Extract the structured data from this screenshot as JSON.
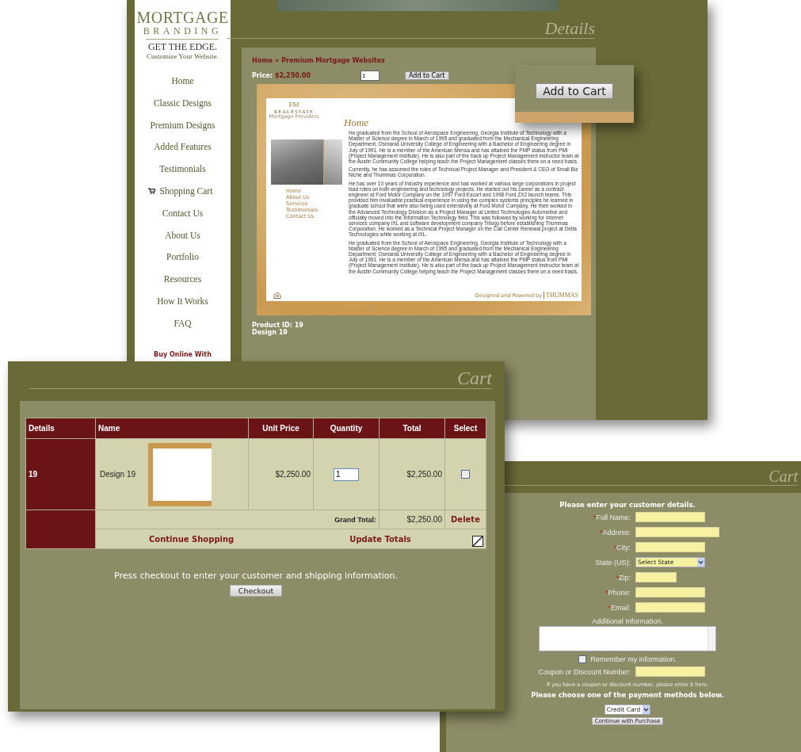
{
  "details_window": {
    "logo": {
      "line1": "MORTGAGE",
      "line2": "BRANDING",
      "tagline": "GET THE EDGE.",
      "subtagline": "Customize Your Website."
    },
    "nav": [
      {
        "label": "Home",
        "kind": "link"
      },
      {
        "label": "Classic Designs",
        "kind": "link"
      },
      {
        "label": "Premium Designs",
        "kind": "link"
      },
      {
        "label": "Added Features",
        "kind": "link"
      },
      {
        "label": "Testimonials",
        "kind": "link"
      },
      {
        "label": "Shopping Cart",
        "kind": "cart"
      },
      {
        "label": "Contact Us",
        "kind": "link"
      },
      {
        "label": "About Us",
        "kind": "link"
      },
      {
        "label": "Portfolio",
        "kind": "link"
      },
      {
        "label": "Resources",
        "kind": "link"
      },
      {
        "label": "How It Works",
        "kind": "link"
      },
      {
        "label": "FAQ",
        "kind": "link"
      }
    ],
    "buy_online": "Buy Online With",
    "title": "Details",
    "breadcrumb": {
      "home": "Home",
      "separator": "»",
      "current": "Premium Mortgage Websites"
    },
    "price_label": "Price:",
    "price": "$2,250.00",
    "quantity": "1",
    "add_button": "Add to Cart",
    "preview": {
      "logo_initials": "FM",
      "logo_name": "REALESTATE",
      "logo_sub": "Mortgage Providers",
      "heading": "Home",
      "nav": [
        "Home",
        "About Us",
        "Services",
        "Testimonials",
        "Contact Us"
      ],
      "paragraphs": [
        "He graduated from the School of Aerospace Engineering, Georgia Institute of Technology with a Master of Science degree in March of 1995 and graduated from the Mechanical Engineering Department, Osmania University College of Engineering with a Bachelor of Engineering degree in July of 1991. He is a member of the American Mensa and has attained the PMP status from PMI (Project Management Institute). He is also part of the back up Project Management instructor team at the Austin Community College helping teach the Project Management classes there on a need basis.",
        "Currently, he has assumed the roles of Technical Project Manager and President & CEO of Small Biz Niche and Thummas Corporation.",
        "He has over 10 years of industry experience and has worked at various large corporations in project lead roles on both engineering and technology projects. He started out his career as a contract engineer at Ford Motor Company on the 1997 Ford Escort and 1998 Ford ZX2 launch teams. This provided him invaluable practical experience in using the complex systems principles he learned in graduate school that were also being used extensively at Ford Motor Company. He then worked in the Advanced Technology Division as a Project Manager at United Technologies Automotive and officially moved into the Information Technology field. This was followed by working for Internet services company iXL and software development company Trilogy before establishing Thummas Corporation. He worked as a Technical Project Manager on the Call Center Renewal project at Delta Technologies while working at iXL.",
        "He graduated from the School of Aerospace Engineering, Georgia Institute of Technology with a Master of Science degree in March of 1995 and graduated from the Mechanical Engineering Department, Osmania University College of Engineering with a Bachelor of Engineering degree in July of 1991. He is a member of the American Mensa and has attained the PMP status from PMI (Project Management Institute). He is also part of the back up Project Management instructor team at the Austin Community College helping teach the Project Management classes there on a need basis."
      ],
      "credit": "Designed and Powered by",
      "credit_brand": "THUMMAS"
    },
    "product_id": "Product ID: 19",
    "design": "Design 19"
  },
  "zoom_callout": {
    "button": "Add to Cart"
  },
  "cart_window": {
    "title": "Cart",
    "columns": [
      "Details",
      "Name",
      "Unit Price",
      "Quantity",
      "Total",
      "Select"
    ],
    "rows": [
      {
        "details": "19",
        "name": "Design 19",
        "unit_price": "$2,250.00",
        "quantity": "1",
        "total": "$2,250.00",
        "checked": false
      }
    ],
    "grand_total_label": "Grand Total:",
    "grand_total": "$2,250.00",
    "delete": "Delete",
    "continue": "Continue Shopping",
    "update": "Update Totals",
    "message": "Press checkout to enter your customer and shipping information.",
    "checkout": "Checkout"
  },
  "checkout_window": {
    "title": "Cart",
    "heading": "Please enter your customer details.",
    "fields": [
      {
        "required_mark": "*",
        "label": "Full Name:",
        "kind": "text"
      },
      {
        "required_mark": "*",
        "label": "Address:",
        "kind": "longtext"
      },
      {
        "required_mark": "*",
        "label": "City:",
        "kind": "text"
      },
      {
        "label": "State (US):",
        "kind": "select",
        "value": "Select State"
      },
      {
        "required_mark": "*",
        "label": "Zip:",
        "kind": "shorttext"
      },
      {
        "required_mark": "*",
        "label": "Phone:",
        "kind": "text"
      },
      {
        "required_mark": "*",
        "label": "Email:",
        "kind": "text"
      }
    ],
    "additional_label": "Additional Information.",
    "remember": {
      "label": "Remember my information.",
      "checked": false
    },
    "coupon_label": "Coupon or Discount Number:",
    "coupon_hint": "If you have a coupon or discount number, please enter it here.",
    "payment_heading": "Please choose one of the payment methods below.",
    "payment_method": "Credit Card",
    "continue_button": "Continue with Purchase"
  }
}
